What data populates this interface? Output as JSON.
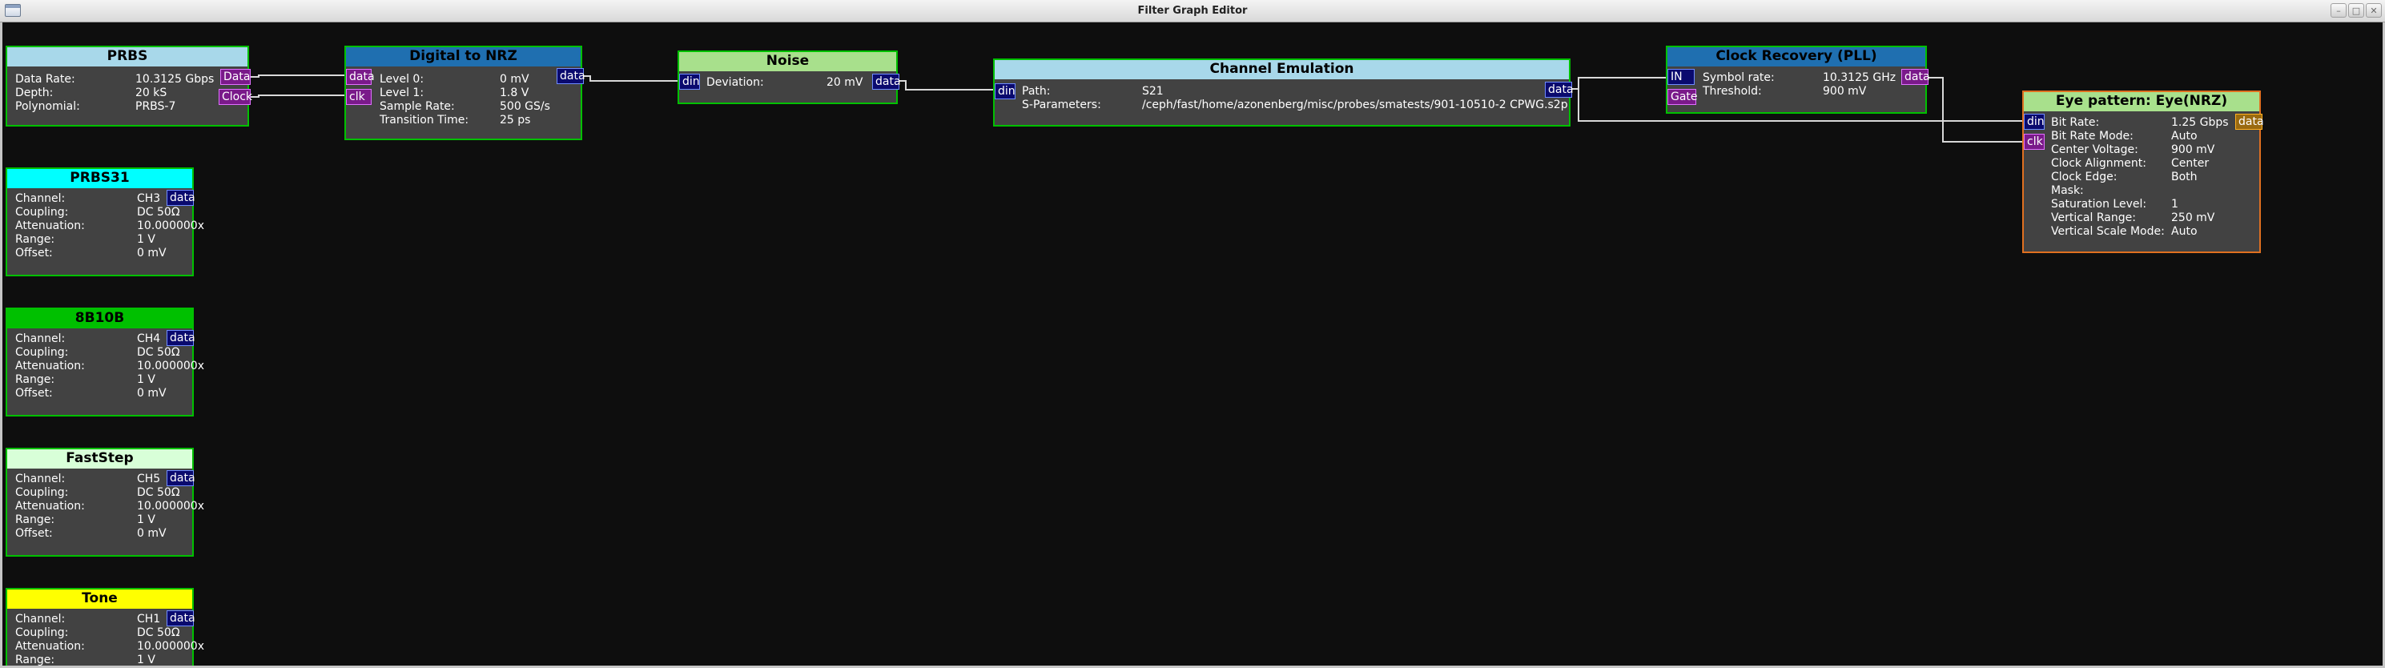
{
  "window": {
    "title": "Filter Graph Editor",
    "controls": [
      "–",
      "□",
      "✕"
    ]
  },
  "colors": {
    "canvas": "#0e0e0e",
    "node_body": "#424242",
    "header_light_blue": "#a8d8ea",
    "header_blue": "#1f6fb0",
    "header_light_green": "#a8e08c",
    "header_cyan": "#00ffff",
    "header_green": "#00c000",
    "header_pale_green": "#d8ffd8",
    "header_yellow": "#ffff00",
    "border_green": "#00c000",
    "border_orange": "#e07020",
    "port_data": "#0a0a6e",
    "port_clock": "#7a1a8a",
    "wire": "#d8d8d8"
  },
  "nodes": {
    "prbs": {
      "title": "PRBS",
      "params": [
        {
          "label": "Data Rate:",
          "value": "10.3125 Gbps"
        },
        {
          "label": "Depth:",
          "value": "20 kS"
        },
        {
          "label": "Polynomial:",
          "value": "PRBS-7"
        }
      ],
      "outputs": [
        "Data",
        "Clock"
      ]
    },
    "nrz": {
      "title": "Digital to NRZ",
      "inputs": [
        "data",
        "clk"
      ],
      "params": [
        {
          "label": "Level 0:",
          "value": "0 mV"
        },
        {
          "label": "Level 1:",
          "value": "1.8 V"
        },
        {
          "label": "Sample Rate:",
          "value": "500 GS/s"
        },
        {
          "label": "Transition Time:",
          "value": "25 ps"
        }
      ],
      "outputs": [
        "data"
      ]
    },
    "noise": {
      "title": "Noise",
      "inputs": [
        "din"
      ],
      "params": [
        {
          "label": "Deviation:",
          "value": "20 mV"
        }
      ],
      "outputs": [
        "data"
      ]
    },
    "channel": {
      "title": "Channel Emulation",
      "inputs": [
        "din"
      ],
      "params": [
        {
          "label": "Path:",
          "value": "S21"
        },
        {
          "label": "S-Parameters:",
          "value": "/ceph/fast/home/azonenberg/misc/probes/smatests/901-10510-2 CPWG.s2p"
        }
      ],
      "outputs": [
        "data"
      ]
    },
    "cdr": {
      "title": "Clock Recovery (PLL)",
      "inputs": [
        "IN",
        "Gate"
      ],
      "params": [
        {
          "label": "Symbol rate:",
          "value": "10.3125 GHz"
        },
        {
          "label": "Threshold:",
          "value": "900 mV"
        }
      ],
      "outputs": [
        "data"
      ]
    },
    "eye": {
      "title": "Eye pattern: Eye(NRZ)",
      "inputs": [
        "din",
        "clk"
      ],
      "params": [
        {
          "label": "Bit Rate:",
          "value": "1.25 Gbps"
        },
        {
          "label": "Bit Rate Mode:",
          "value": "Auto"
        },
        {
          "label": "Center Voltage:",
          "value": "900 mV"
        },
        {
          "label": "Clock Alignment:",
          "value": "Center"
        },
        {
          "label": "Clock Edge:",
          "value": "Both"
        },
        {
          "label": "Mask:",
          "value": ""
        },
        {
          "label": "Saturation Level:",
          "value": "1"
        },
        {
          "label": "Vertical Range:",
          "value": "250 mV"
        },
        {
          "label": "Vertical Scale Mode:",
          "value": "Auto"
        }
      ],
      "outputs": [
        "data"
      ]
    },
    "ch3": {
      "title": "PRBS31",
      "params": [
        {
          "label": "Channel:",
          "value": "CH3"
        },
        {
          "label": "Coupling:",
          "value": "DC 50Ω"
        },
        {
          "label": "Attenuation:",
          "value": "10.000000x"
        },
        {
          "label": "Range:",
          "value": "1 V"
        },
        {
          "label": "Offset:",
          "value": "0 mV"
        }
      ],
      "outputs": [
        "data"
      ]
    },
    "ch4": {
      "title": "8B10B",
      "params": [
        {
          "label": "Channel:",
          "value": "CH4"
        },
        {
          "label": "Coupling:",
          "value": "DC 50Ω"
        },
        {
          "label": "Attenuation:",
          "value": "10.000000x"
        },
        {
          "label": "Range:",
          "value": "1 V"
        },
        {
          "label": "Offset:",
          "value": "0 mV"
        }
      ],
      "outputs": [
        "data"
      ]
    },
    "ch5": {
      "title": "FastStep",
      "params": [
        {
          "label": "Channel:",
          "value": "CH5"
        },
        {
          "label": "Coupling:",
          "value": "DC 50Ω"
        },
        {
          "label": "Attenuation:",
          "value": "10.000000x"
        },
        {
          "label": "Range:",
          "value": "1 V"
        },
        {
          "label": "Offset:",
          "value": "0 mV"
        }
      ],
      "outputs": [
        "data"
      ]
    },
    "ch1": {
      "title": "Tone",
      "params": [
        {
          "label": "Channel:",
          "value": "CH1"
        },
        {
          "label": "Coupling:",
          "value": "DC 50Ω"
        },
        {
          "label": "Attenuation:",
          "value": "10.000000x"
        },
        {
          "label": "Range:",
          "value": "1 V"
        }
      ],
      "outputs": [
        "data"
      ]
    }
  }
}
